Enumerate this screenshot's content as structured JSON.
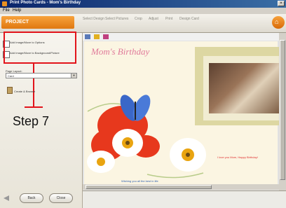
{
  "window": {
    "title": "Print Photo Cards - Mom's Birthday",
    "close_glyph": "×"
  },
  "menu": [
    "File",
    "Help"
  ],
  "header": {
    "logo_text": "PROJECT",
    "tabs": [
      "Select Design",
      "Select Pictures",
      "Crop",
      "Adjust",
      "Print",
      "Design Card"
    ]
  },
  "left_pane": {
    "options": [
      {
        "icon": "add-image-icon",
        "label": "Add Image/Move to Options"
      },
      {
        "icon": "add-image-icon",
        "label": "Add Image/Move to Background/Picture"
      }
    ],
    "select_label": "Page Layout:",
    "select_value": "Card",
    "create_label": "Create & Browse",
    "annotation_label": "Step 7",
    "nav": {
      "back": "Back",
      "close": "Close"
    }
  },
  "card": {
    "title": "Mom's Birthday",
    "photo_caption": "I love you Mom, Happy Birthday!",
    "sub_caption": "Wishing you all the best in life"
  },
  "colors": {
    "accent_orange": "#f08a1c",
    "annotation_red": "#e2141b",
    "title_pink": "#e07a9a"
  }
}
